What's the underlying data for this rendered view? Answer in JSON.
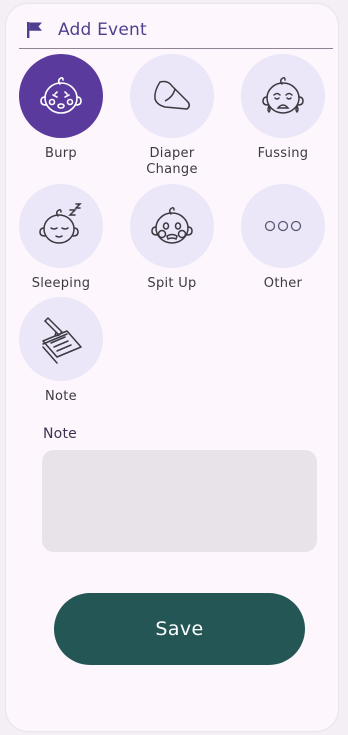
{
  "header": {
    "title": "Add Event",
    "icon": "flag-icon"
  },
  "events": [
    {
      "label": "Burp",
      "icon": "baby-burp-icon",
      "selected": true
    },
    {
      "label": "Diaper\nChange",
      "icon": "diaper-icon",
      "selected": false
    },
    {
      "label": "Fussing",
      "icon": "baby-crying-icon",
      "selected": false
    },
    {
      "label": "Sleeping",
      "icon": "baby-sleeping-icon",
      "selected": false
    },
    {
      "label": "Spit Up",
      "icon": "baby-spit-up-icon",
      "selected": false
    },
    {
      "label": "Other",
      "icon": "more-dots-icon",
      "selected": false
    },
    {
      "label": "Note",
      "icon": "notepad-pencil-icon",
      "selected": false
    }
  ],
  "note": {
    "heading": "Note",
    "value": ""
  },
  "save_label": "Save",
  "colors": {
    "accent": "#5a3a9c",
    "circle_bg": "#ebe6f8",
    "save_button": "#255656",
    "title_text": "#4f3f8e"
  }
}
